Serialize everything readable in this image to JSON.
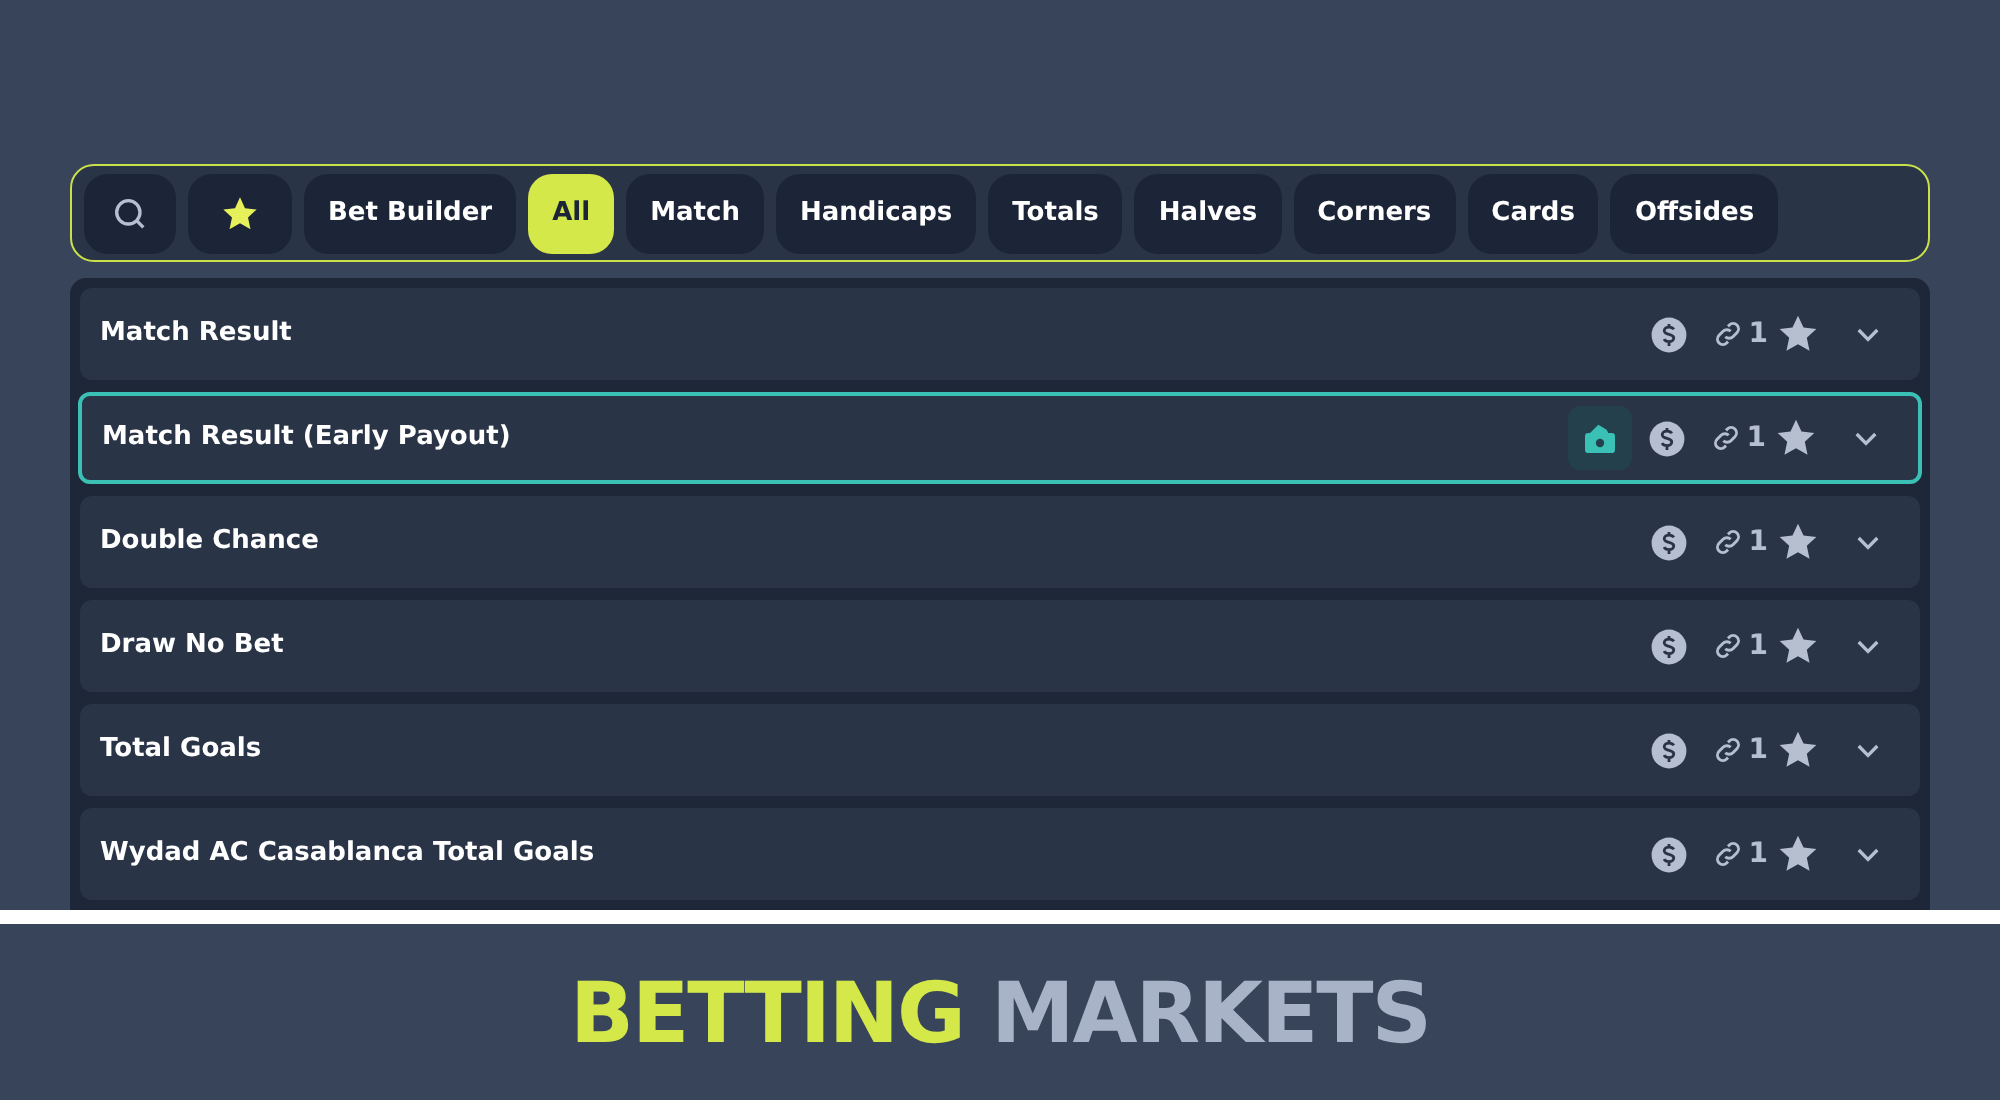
{
  "filters": [
    {
      "kind": "search",
      "selected": false
    },
    {
      "kind": "favorites",
      "selected": false
    },
    {
      "kind": "text",
      "label": "Bet Builder",
      "selected": false
    },
    {
      "kind": "text",
      "label": "All",
      "selected": true
    },
    {
      "kind": "text",
      "label": "Match",
      "selected": false
    },
    {
      "kind": "text",
      "label": "Handicaps",
      "selected": false
    },
    {
      "kind": "text",
      "label": "Totals",
      "selected": false
    },
    {
      "kind": "text",
      "label": "Halves",
      "selected": false
    },
    {
      "kind": "text",
      "label": "Corners",
      "selected": false
    },
    {
      "kind": "text",
      "label": "Cards",
      "selected": false
    },
    {
      "kind": "text",
      "label": "Offsides",
      "selected": false
    }
  ],
  "markets": [
    {
      "name": "Match Result",
      "cash_out": false,
      "link_count": "1"
    },
    {
      "name": "Match Result (Early Payout)",
      "cash_out": true,
      "link_count": "1"
    },
    {
      "name": "Double Chance",
      "cash_out": false,
      "link_count": "1"
    },
    {
      "name": "Draw No Bet",
      "cash_out": false,
      "link_count": "1"
    },
    {
      "name": "Total Goals",
      "cash_out": false,
      "link_count": "1"
    },
    {
      "name": "Wydad AC Casablanca Total Goals",
      "cash_out": false,
      "link_count": "1"
    }
  ],
  "banner": {
    "highlight": "BETTING",
    "rest": "MARKETS"
  }
}
